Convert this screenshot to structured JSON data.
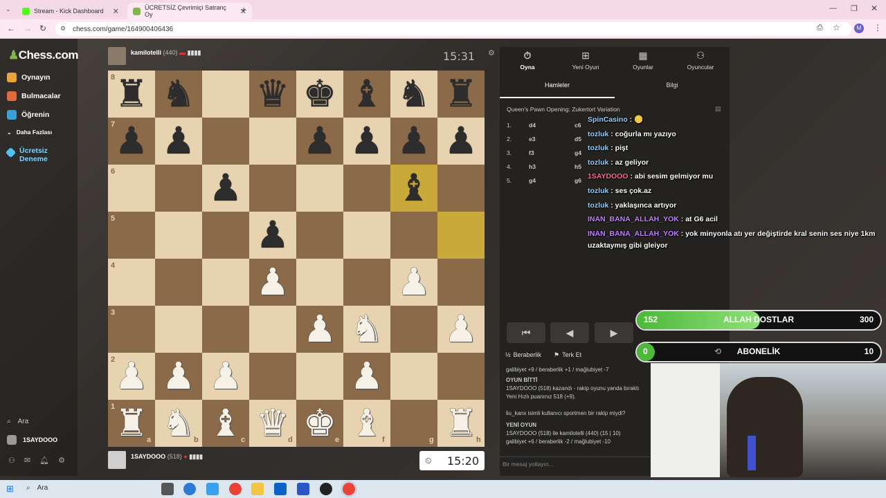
{
  "browser": {
    "tabs": [
      {
        "title": "Stream - Kick Dashboard",
        "favicon_color": "#53fc18"
      },
      {
        "title": "ÜCRETSİZ Çevrimiçi Satranç Oy",
        "favicon_color": "#81b64c"
      }
    ],
    "new_tab": "+",
    "url": "chess.com/game/164900406436"
  },
  "site": {
    "logo": "Chess.com",
    "nav": [
      {
        "label": "Oynayın",
        "icon": "play-icon"
      },
      {
        "label": "Bulmacalar",
        "icon": "puzzle-icon"
      },
      {
        "label": "Öğrenin",
        "icon": "learn-icon"
      },
      {
        "label": "Daha Fazlası",
        "icon": "more-icon"
      },
      {
        "label": "Ücretsiz Deneme",
        "icon": "diamond-icon"
      }
    ],
    "search": "Ara",
    "username": "1SAYDOOO"
  },
  "game": {
    "top_player": {
      "name": "kamilotelli",
      "rating": "(440)",
      "clock": "15:31"
    },
    "bottom_player": {
      "name": "1SAYDOOO",
      "rating": "(518)",
      "clock": "15:20"
    },
    "ranks": [
      "8",
      "7",
      "6",
      "5",
      "4",
      "3",
      "2",
      "1"
    ],
    "files": [
      "a",
      "b",
      "c",
      "d",
      "e",
      "f",
      "g",
      "h"
    ],
    "board": [
      [
        "r",
        "n",
        "",
        "q",
        "k",
        "b",
        "n",
        "r"
      ],
      [
        "p",
        "p",
        "",
        "",
        "p",
        "p",
        "p",
        "p"
      ],
      [
        "",
        "",
        "p",
        "",
        "",
        "",
        "b",
        ""
      ],
      [
        "",
        "",
        "",
        "p",
        "",
        "",
        "",
        ""
      ],
      [
        "",
        "",
        "",
        "P",
        "",
        "",
        "P",
        ""
      ],
      [
        "",
        "",
        "",
        "",
        "P",
        "N",
        "",
        "P"
      ],
      [
        "P",
        "P",
        "P",
        "",
        "",
        "P",
        "",
        ""
      ],
      [
        "R",
        "N",
        "B",
        "Q",
        "K",
        "B",
        "",
        "R"
      ]
    ],
    "highlight_squares": [
      "g6",
      "h5"
    ]
  },
  "panel": {
    "top_tabs": [
      {
        "label": "Oyna",
        "icon": "stopwatch-icon"
      },
      {
        "label": "Yeni Oyun",
        "icon": "plus-icon"
      },
      {
        "label": "Oyunlar",
        "icon": "grid-icon"
      },
      {
        "label": "Oyuncular",
        "icon": "players-icon"
      }
    ],
    "sub_tabs": [
      "Hamleler",
      "Bilgi"
    ],
    "opening": "Queen's Pawn Opening: Zukertort Variation",
    "moves": [
      {
        "n": "1.",
        "w": "d4",
        "b": "c6"
      },
      {
        "n": "2.",
        "w": "e3",
        "b": "d5"
      },
      {
        "n": "3.",
        "w": "f3",
        "b": "g4"
      },
      {
        "n": "4.",
        "w": "h3",
        "b": "h5"
      },
      {
        "n": "5.",
        "w": "g4",
        "b": "g6"
      }
    ],
    "controls": [
      "⏮",
      "◀",
      "▶",
      "▷",
      "⏭"
    ],
    "draw": "Beraberlik",
    "resign": "Terk Et",
    "log": [
      "galibiyet +9 / beraberlik +1 / mağlubiyet -7",
      "OYUN BİTTİ",
      "1SAYDOOO (518) kazandı - rakip oyunu yanda bıraktı",
      "Yeni Hızlı puanınız 518 (+9).",
      "liu_kanx isimli kullanıcı sportmen bir rakip miydi?",
      "YENİ OYUN",
      "1SAYDOOO (518) ile kamilotelli (440) (15 | 10)",
      "galibiyet +6 / beraberlik -2 / mağlubiyet -10"
    ],
    "chat_placeholder": "Bir mesaj yollayın..."
  },
  "chat": [
    {
      "user": "SpinCasino",
      "msg": "🪙",
      "cls": "cn"
    },
    {
      "user": "tozluk",
      "msg": "coğurla mı yazıyo",
      "cls": "cn"
    },
    {
      "user": "tozluk",
      "msg": "pişt",
      "cls": "cn"
    },
    {
      "user": "tozluk",
      "msg": "az geliyor",
      "cls": "cn"
    },
    {
      "user": "1SAYDOOO",
      "msg": "abi sesim gelmiyor mu",
      "cls": "cr"
    },
    {
      "user": "tozluk",
      "msg": "ses çok.az",
      "cls": "cn"
    },
    {
      "user": "tozluk",
      "msg": "yaklaşınca artıyor",
      "cls": "cn"
    },
    {
      "user": "INAN_BANA_ALLAH_YOK",
      "msg": "at G6 acil",
      "cls": "cp"
    },
    {
      "user": "INAN_BANA_ALLAH_YOK",
      "msg": "yok minyonla atı yer değiştirde kral senin ses niye 1km uzaktaymış gibi gleiyor",
      "cls": "cp"
    }
  ],
  "goals": [
    {
      "current": "152",
      "label": "ALLAH DOSTLAR",
      "target": "300",
      "progress": 0.507,
      "color": "#5fc54a"
    },
    {
      "current": "0",
      "label": "ABONELİK",
      "target": "10",
      "progress": 0.0,
      "color": "#5fc54a"
    }
  ],
  "taskbar": {
    "search": "Ara"
  }
}
